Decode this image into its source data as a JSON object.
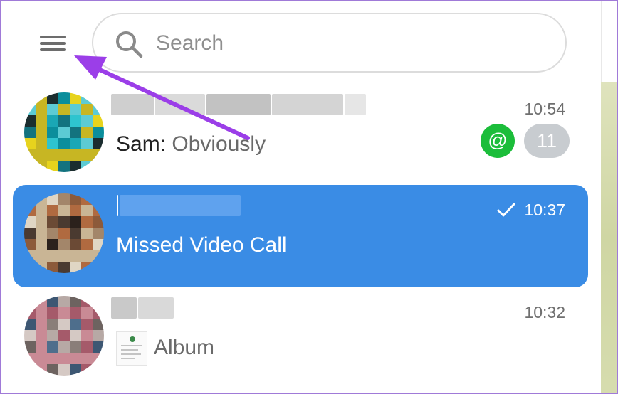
{
  "search": {
    "placeholder": "Search"
  },
  "chats": [
    {
      "time": "10:54",
      "sender": "Sam:",
      "message": " Obviously",
      "mention_badge": "@",
      "unread_count": "11"
    },
    {
      "time": "10:37",
      "message": "Missed Video Call",
      "read_check": "check-icon"
    },
    {
      "time": "10:32",
      "message": "Album"
    }
  ],
  "colors": {
    "accent_selected": "#3a8ce5",
    "mention_badge": "#1bbd3a",
    "unread_badge": "#c8ccd0",
    "annotation_arrow": "#9b3ee8"
  }
}
